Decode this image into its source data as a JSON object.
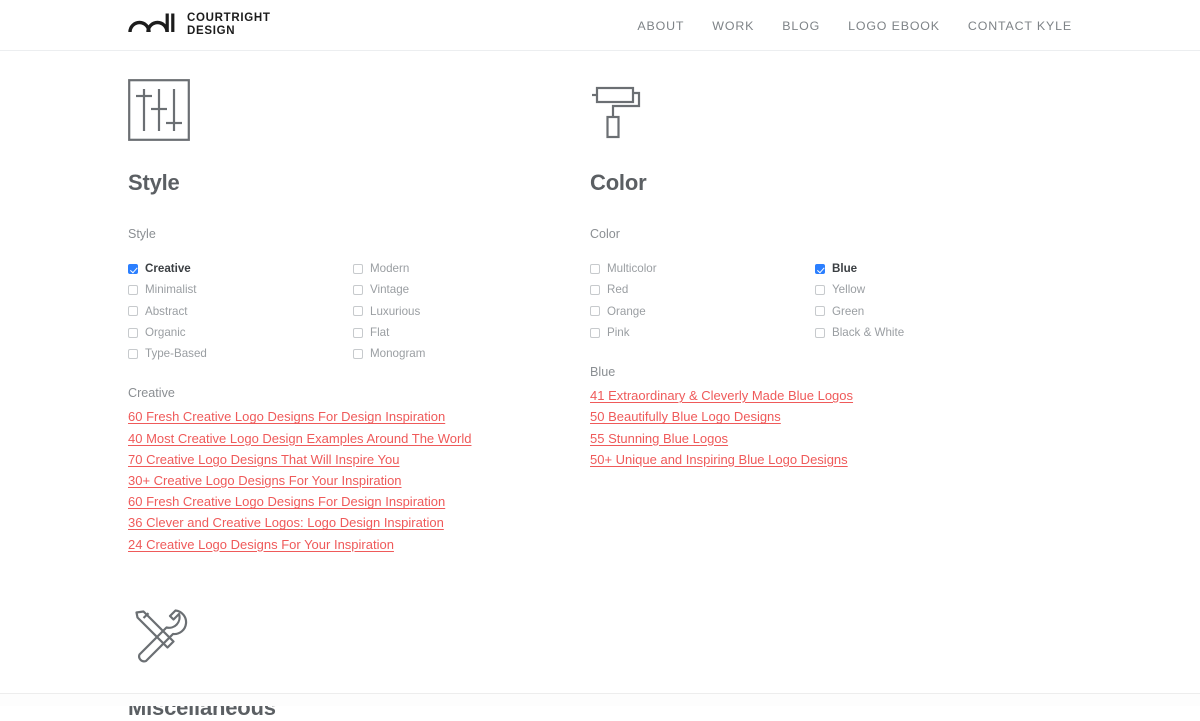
{
  "header": {
    "brand": {
      "line1": "COURTRIGHT",
      "line2": "DESIGN",
      "mark_icon": "courtright-arches-logomark"
    },
    "nav": [
      {
        "label": "ABOUT"
      },
      {
        "label": "WORK"
      },
      {
        "label": "BLOG"
      },
      {
        "label": "LOGO EBOOK"
      },
      {
        "label": "CONTACT KYLE"
      }
    ]
  },
  "colors": {
    "link": "#ef5a5a",
    "checkbox_checked": "#2b7fff",
    "heading": "#5b5f63",
    "muted_text": "#8b8f93",
    "checkbox_label": "#9a9ea2",
    "nav_text": "#7e8387",
    "border": "#eceef0"
  },
  "sections": [
    {
      "id": "style",
      "icon": "equalizer-sliders-icon",
      "title": "Style",
      "field_label": "Style",
      "checkbox_columns": [
        [
          {
            "label": "Creative",
            "checked": true
          },
          {
            "label": "Minimalist",
            "checked": false
          },
          {
            "label": "Abstract",
            "checked": false
          },
          {
            "label": "Organic",
            "checked": false
          },
          {
            "label": "Type-Based",
            "checked": false
          }
        ],
        [
          {
            "label": "Modern",
            "checked": false
          },
          {
            "label": "Vintage",
            "checked": false
          },
          {
            "label": "Luxurious",
            "checked": false
          },
          {
            "label": "Flat",
            "checked": false
          },
          {
            "label": "Monogram",
            "checked": false
          }
        ]
      ],
      "results_heading": "Creative",
      "results": [
        {
          "label": "60 Fresh Creative Logo Designs For Design Inspiration "
        },
        {
          "label": "40 Most Creative Logo Design Examples Around The World "
        },
        {
          "label": "70 Creative Logo Designs That Will Inspire You "
        },
        {
          "label": "30+ Creative Logo Designs For Your Inspiration "
        },
        {
          "label": "60 Fresh Creative Logo Designs For Design Inspiration "
        },
        {
          "label": "36 Clever and Creative Logos: Logo Design Inspiration "
        },
        {
          "label": "24 Creative Logo Designs For Your Inspiration "
        }
      ]
    },
    {
      "id": "color",
      "icon": "paint-roller-icon",
      "title": "Color",
      "field_label": "Color",
      "checkbox_columns": [
        [
          {
            "label": "Multicolor",
            "checked": false
          },
          {
            "label": "Red",
            "checked": false
          },
          {
            "label": "Orange",
            "checked": false
          },
          {
            "label": "Pink",
            "checked": false
          }
        ],
        [
          {
            "label": "Blue",
            "checked": true
          },
          {
            "label": "Yellow",
            "checked": false
          },
          {
            "label": "Green",
            "checked": false
          },
          {
            "label": "Black & White",
            "checked": false
          }
        ]
      ],
      "results_heading": "Blue",
      "results": [
        {
          "label": "41 Extraordinary & Cleverly Made Blue Logos "
        },
        {
          "label": "50 Beautifully Blue Logo Designs "
        },
        {
          "label": "55 Stunning Blue Logos "
        },
        {
          "label": "50+ Unique and Inspiring Blue Logo Designs "
        }
      ]
    }
  ],
  "misc": {
    "id": "miscellaneous",
    "icon": "wrench-screwdriver-tools-icon",
    "title": "Miscellaneous"
  }
}
